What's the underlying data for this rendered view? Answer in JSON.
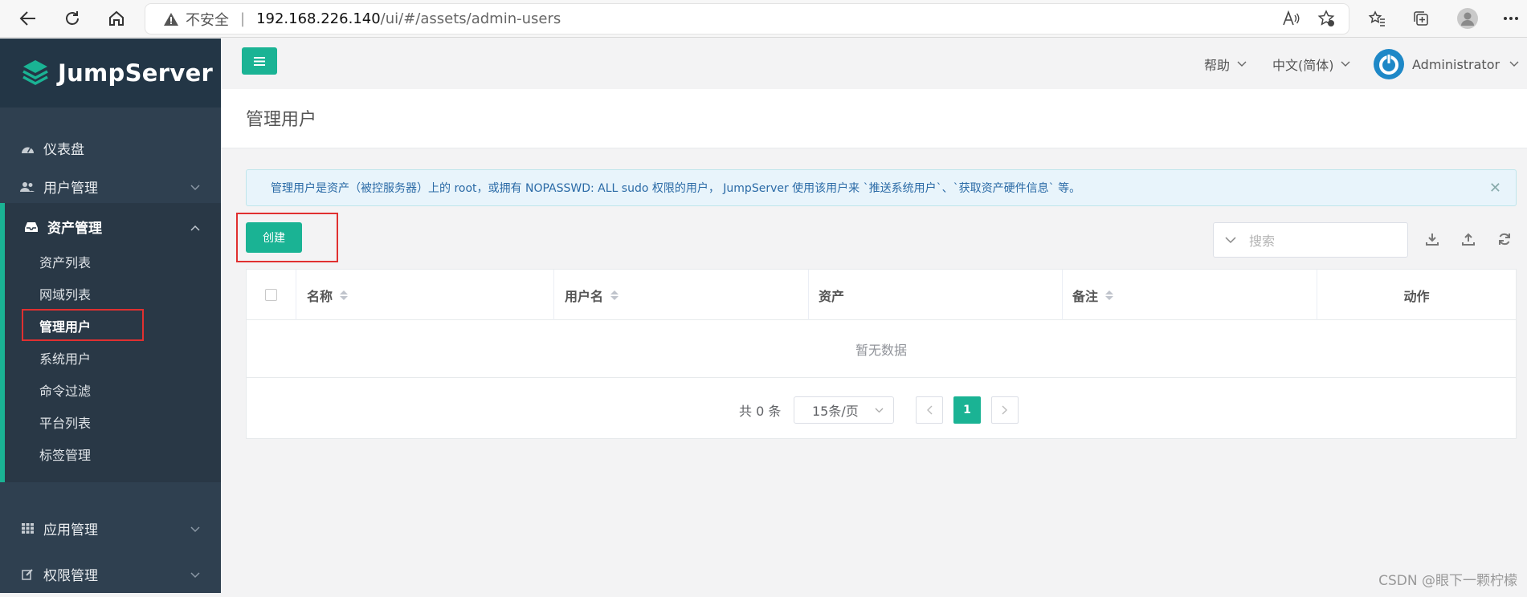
{
  "browser": {
    "security_label": "不安全",
    "url_host": "192.168.226.140",
    "url_path": "/ui/#/assets/admin-users"
  },
  "sidebar": {
    "brand": "JumpServer",
    "items": [
      {
        "label": "仪表盘",
        "icon": "dashboard-icon"
      },
      {
        "label": "用户管理",
        "icon": "users-icon"
      },
      {
        "label": "资产管理",
        "icon": "inbox-icon",
        "expanded": true
      },
      {
        "label": "应用管理",
        "icon": "grid-icon"
      },
      {
        "label": "权限管理",
        "icon": "edit-icon"
      }
    ],
    "asset_submenu": [
      "资产列表",
      "网域列表",
      "管理用户",
      "系统用户",
      "命令过滤",
      "平台列表",
      "标签管理"
    ],
    "active_sub": "管理用户"
  },
  "topbar": {
    "help": "帮助",
    "language": "中文(简体)",
    "user": "Administrator"
  },
  "page": {
    "title": "管理用户",
    "alert": "管理用户是资产（被控服务器）上的 root，或拥有 NOPASSWD: ALL sudo 权限的用户， JumpServer 使用该用户来 `推送系统用户`、`获取资产硬件信息` 等。",
    "create_label": "创建",
    "search_placeholder": "搜索"
  },
  "table": {
    "columns": [
      "名称",
      "用户名",
      "资产",
      "备注",
      "动作"
    ],
    "empty_text": "暂无数据"
  },
  "pagination": {
    "total": "共 0 条",
    "page_size": "15条/页",
    "current_page": "1"
  },
  "watermark": "CSDN @眼下一颗柠檬",
  "colors": {
    "accent": "#1ab394",
    "sidebar": "#2f4050",
    "highlight": "#e03030"
  }
}
